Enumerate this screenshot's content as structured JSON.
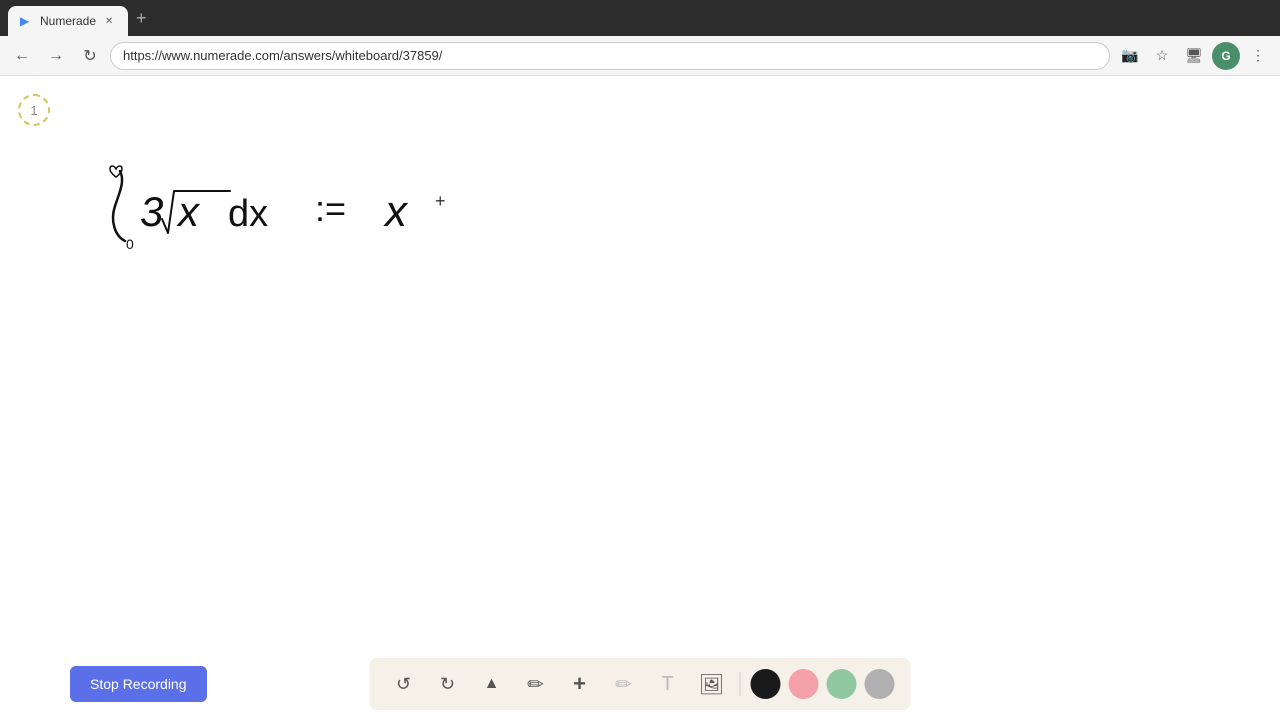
{
  "browser": {
    "tab_label": "Numerade",
    "url": "https://www.numerade.com/answers/whiteboard/37859/",
    "new_tab_symbol": "+",
    "nav": {
      "back": "←",
      "forward": "→",
      "refresh": "↻"
    },
    "toolbar_icons": [
      "📷",
      "★",
      "🖥",
      "G",
      "⋮"
    ]
  },
  "page_indicator": "1",
  "cursor_symbol": "+",
  "bottom_bar": {
    "stop_recording_label": "Stop Recording",
    "toolbar": {
      "undo_label": "↺",
      "redo_label": "↻",
      "select_label": "▲",
      "pen_label": "✎",
      "plus_label": "+",
      "highlighter_label": "/",
      "text_label": "T",
      "image_label": "🖼",
      "colors": [
        "black",
        "pink",
        "mint",
        "gray"
      ]
    }
  }
}
